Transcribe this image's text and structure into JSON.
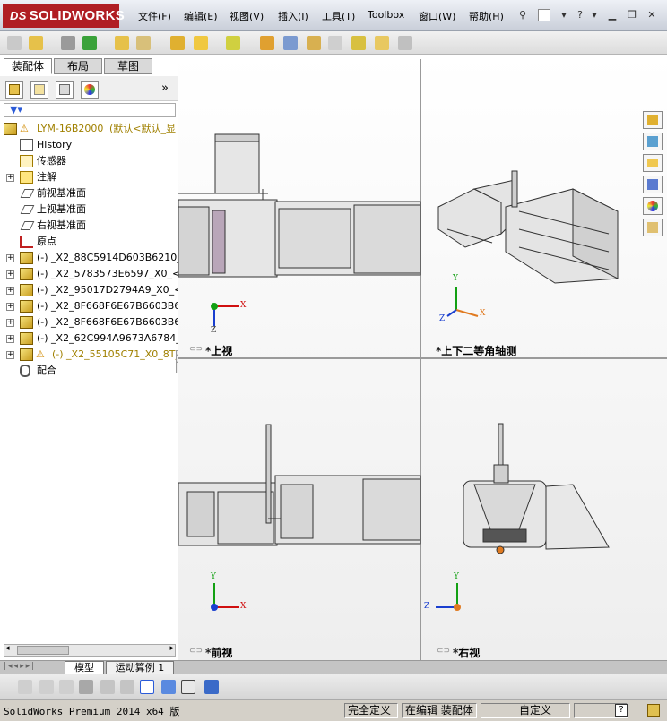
{
  "titlebar": {
    "brand": "SOLIDWORKS",
    "brand_mark": "DS",
    "menus": [
      "文件(F)",
      "编辑(E)",
      "视图(V)",
      "插入(I)",
      "工具(T)",
      "Toolbox",
      "窗口(W)",
      "帮助(H)"
    ],
    "help_glyph": "?"
  },
  "left_panel": {
    "tabs": [
      "装配体",
      "布局",
      "草图"
    ],
    "active_tab": "装配体",
    "tree": [
      {
        "label": "LYM-16B2000",
        "extra": "(默认<默认_显",
        "kind": "root",
        "warning": true
      },
      {
        "label": "History",
        "kind": "history"
      },
      {
        "label": "传感器",
        "kind": "sensor"
      },
      {
        "label": "注解",
        "kind": "annotation",
        "expander": "+"
      },
      {
        "label": "前视基准面",
        "kind": "plane"
      },
      {
        "label": "上视基准面",
        "kind": "plane"
      },
      {
        "label": "右视基准面",
        "kind": "plane"
      },
      {
        "label": "原点",
        "kind": "origin"
      },
      {
        "label": "(-) _X2_88C5914D603B6210_",
        "kind": "component",
        "expander": "+"
      },
      {
        "label": "(-) _X2_5783573E6597_X0_<",
        "kind": "component",
        "expander": "+"
      },
      {
        "label": "(-) _X2_95017D2794A9_X0_<",
        "kind": "component",
        "expander": "+"
      },
      {
        "label": "(-) _X2_8F668F6E67B6603B62",
        "kind": "component",
        "expander": "+"
      },
      {
        "label": "(-) _X2_8F668F6E67B6603B62",
        "kind": "component",
        "expander": "+"
      },
      {
        "label": "(-) _X2_62C994A9673A6784_",
        "kind": "component",
        "expander": "+"
      },
      {
        "label": "(-) _X2_55105C71_X0_8T_",
        "kind": "component-warning",
        "expander": "+"
      },
      {
        "label": "配合",
        "kind": "mates"
      }
    ]
  },
  "viewports": [
    {
      "name": "上视",
      "label": "*上视"
    },
    {
      "name": "上下二等角轴测",
      "label": "*上下二等角轴测"
    },
    {
      "name": "前视",
      "label": "*前视"
    },
    {
      "name": "右视",
      "label": "*右视"
    }
  ],
  "triad": {
    "x": "X",
    "y": "Y",
    "z": "Z"
  },
  "bottom_tabs": [
    "模型",
    "运动算例 1"
  ],
  "status": {
    "product": "SolidWorks Premium 2014 x64 版",
    "definition": "完全定义",
    "editing": "在编辑 装配体",
    "custom": "自定义",
    "help": "?"
  },
  "colors": {
    "brand": "#b01e23",
    "axis_x": "#d01010",
    "axis_y": "#13a013",
    "axis_z": "#1a3fcf"
  }
}
